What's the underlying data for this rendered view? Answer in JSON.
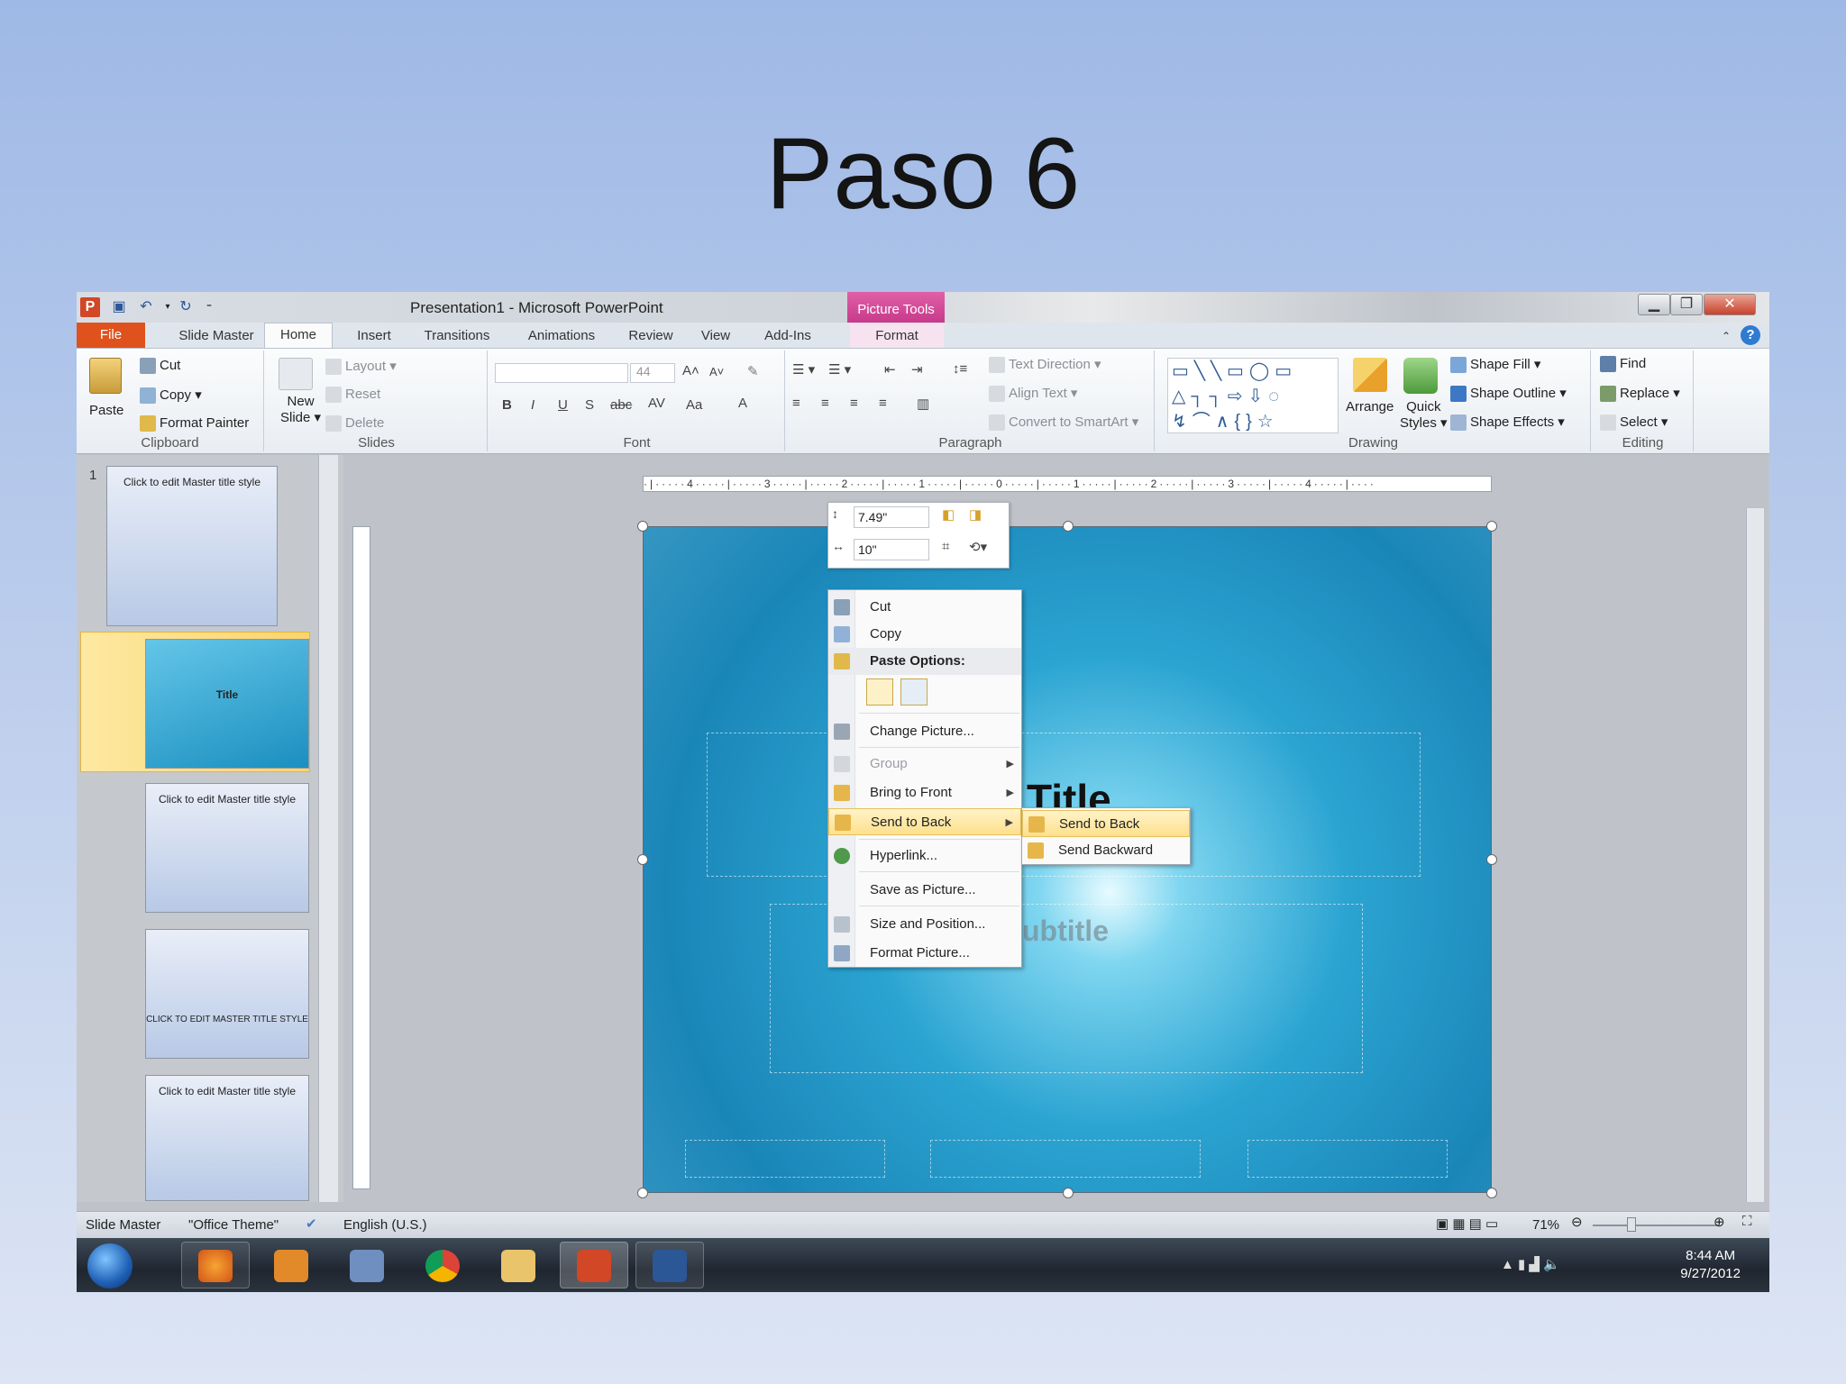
{
  "slide_heading": "Paso 6",
  "window": {
    "title": "Presentation1  -  Microsoft PowerPoint",
    "context_tab_title": "Picture Tools",
    "app_icon": "P"
  },
  "tabs": [
    "File",
    "Slide Master",
    "Home",
    "Insert",
    "Transitions",
    "Animations",
    "Review",
    "View",
    "Add-Ins",
    "Format"
  ],
  "ribbon": {
    "clipboard": {
      "label": "Clipboard",
      "paste": "Paste",
      "cut": "Cut",
      "copy": "Copy",
      "format_painter": "Format Painter"
    },
    "slides": {
      "label": "Slides",
      "new_slide_1": "New",
      "new_slide_2": "Slide",
      "layout": "Layout",
      "reset": "Reset",
      "delete": "Delete"
    },
    "font": {
      "label": "Font",
      "size": "44"
    },
    "paragraph": {
      "label": "Paragraph",
      "text_direction": "Text Direction",
      "align_text": "Align Text",
      "convert_smartart": "Convert to SmartArt"
    },
    "drawing": {
      "label": "Drawing",
      "arrange": "Arrange",
      "quick_styles_1": "Quick",
      "quick_styles_2": "Styles",
      "shape_fill": "Shape Fill",
      "shape_outline": "Shape Outline",
      "shape_effects": "Shape Effects"
    },
    "editing": {
      "label": "Editing",
      "find": "Find",
      "replace": "Replace",
      "select": "Select"
    }
  },
  "thumbnails": {
    "slide_number": "1",
    "items": [
      "Click to edit Master title style",
      "Title",
      "Click to edit Master title style",
      "CLICK TO EDIT MASTER TITLE STYLE",
      "Click to edit Master title style"
    ]
  },
  "canvas": {
    "title_placeholder": "Title",
    "subtitle_placeholder": "ubtitle"
  },
  "mini_toolbar": {
    "height": "7.49\"",
    "width": "10\""
  },
  "context_menu": {
    "items": [
      {
        "label": "Cut",
        "icon": "scissors-icon",
        "disabled": false
      },
      {
        "label": "Copy",
        "icon": "copy-icon",
        "disabled": false
      },
      {
        "label": "Paste Options:",
        "icon": "clipboard-icon",
        "disabled": false
      },
      {
        "label": "Change Picture...",
        "icon": "change-picture-icon",
        "disabled": false
      },
      {
        "label": "Group",
        "icon": "group-icon",
        "disabled": true
      },
      {
        "label": "Bring to Front",
        "icon": "bring-front-icon",
        "disabled": false
      },
      {
        "label": "Send to Back",
        "icon": "send-back-icon",
        "disabled": false
      },
      {
        "label": "Hyperlink...",
        "icon": "globe-icon",
        "disabled": false
      },
      {
        "label": "Save as Picture...",
        "icon": "",
        "disabled": false
      },
      {
        "label": "Size and Position...",
        "icon": "size-icon",
        "disabled": false
      },
      {
        "label": "Format Picture...",
        "icon": "format-icon",
        "disabled": false
      }
    ],
    "submenu": [
      "Send to Back",
      "Send Backward"
    ]
  },
  "status": {
    "view": "Slide Master",
    "theme": "\"Office Theme\"",
    "language": "English (U.S.)",
    "zoom": "71%"
  },
  "taskbar": {
    "time": "8:44 AM",
    "date": "9/27/2012"
  },
  "colors": {
    "file_tab": "#e0521d",
    "picture_tools": "#d04c9a",
    "highlight": "#fde08d",
    "taskbar": "#1f2630"
  }
}
